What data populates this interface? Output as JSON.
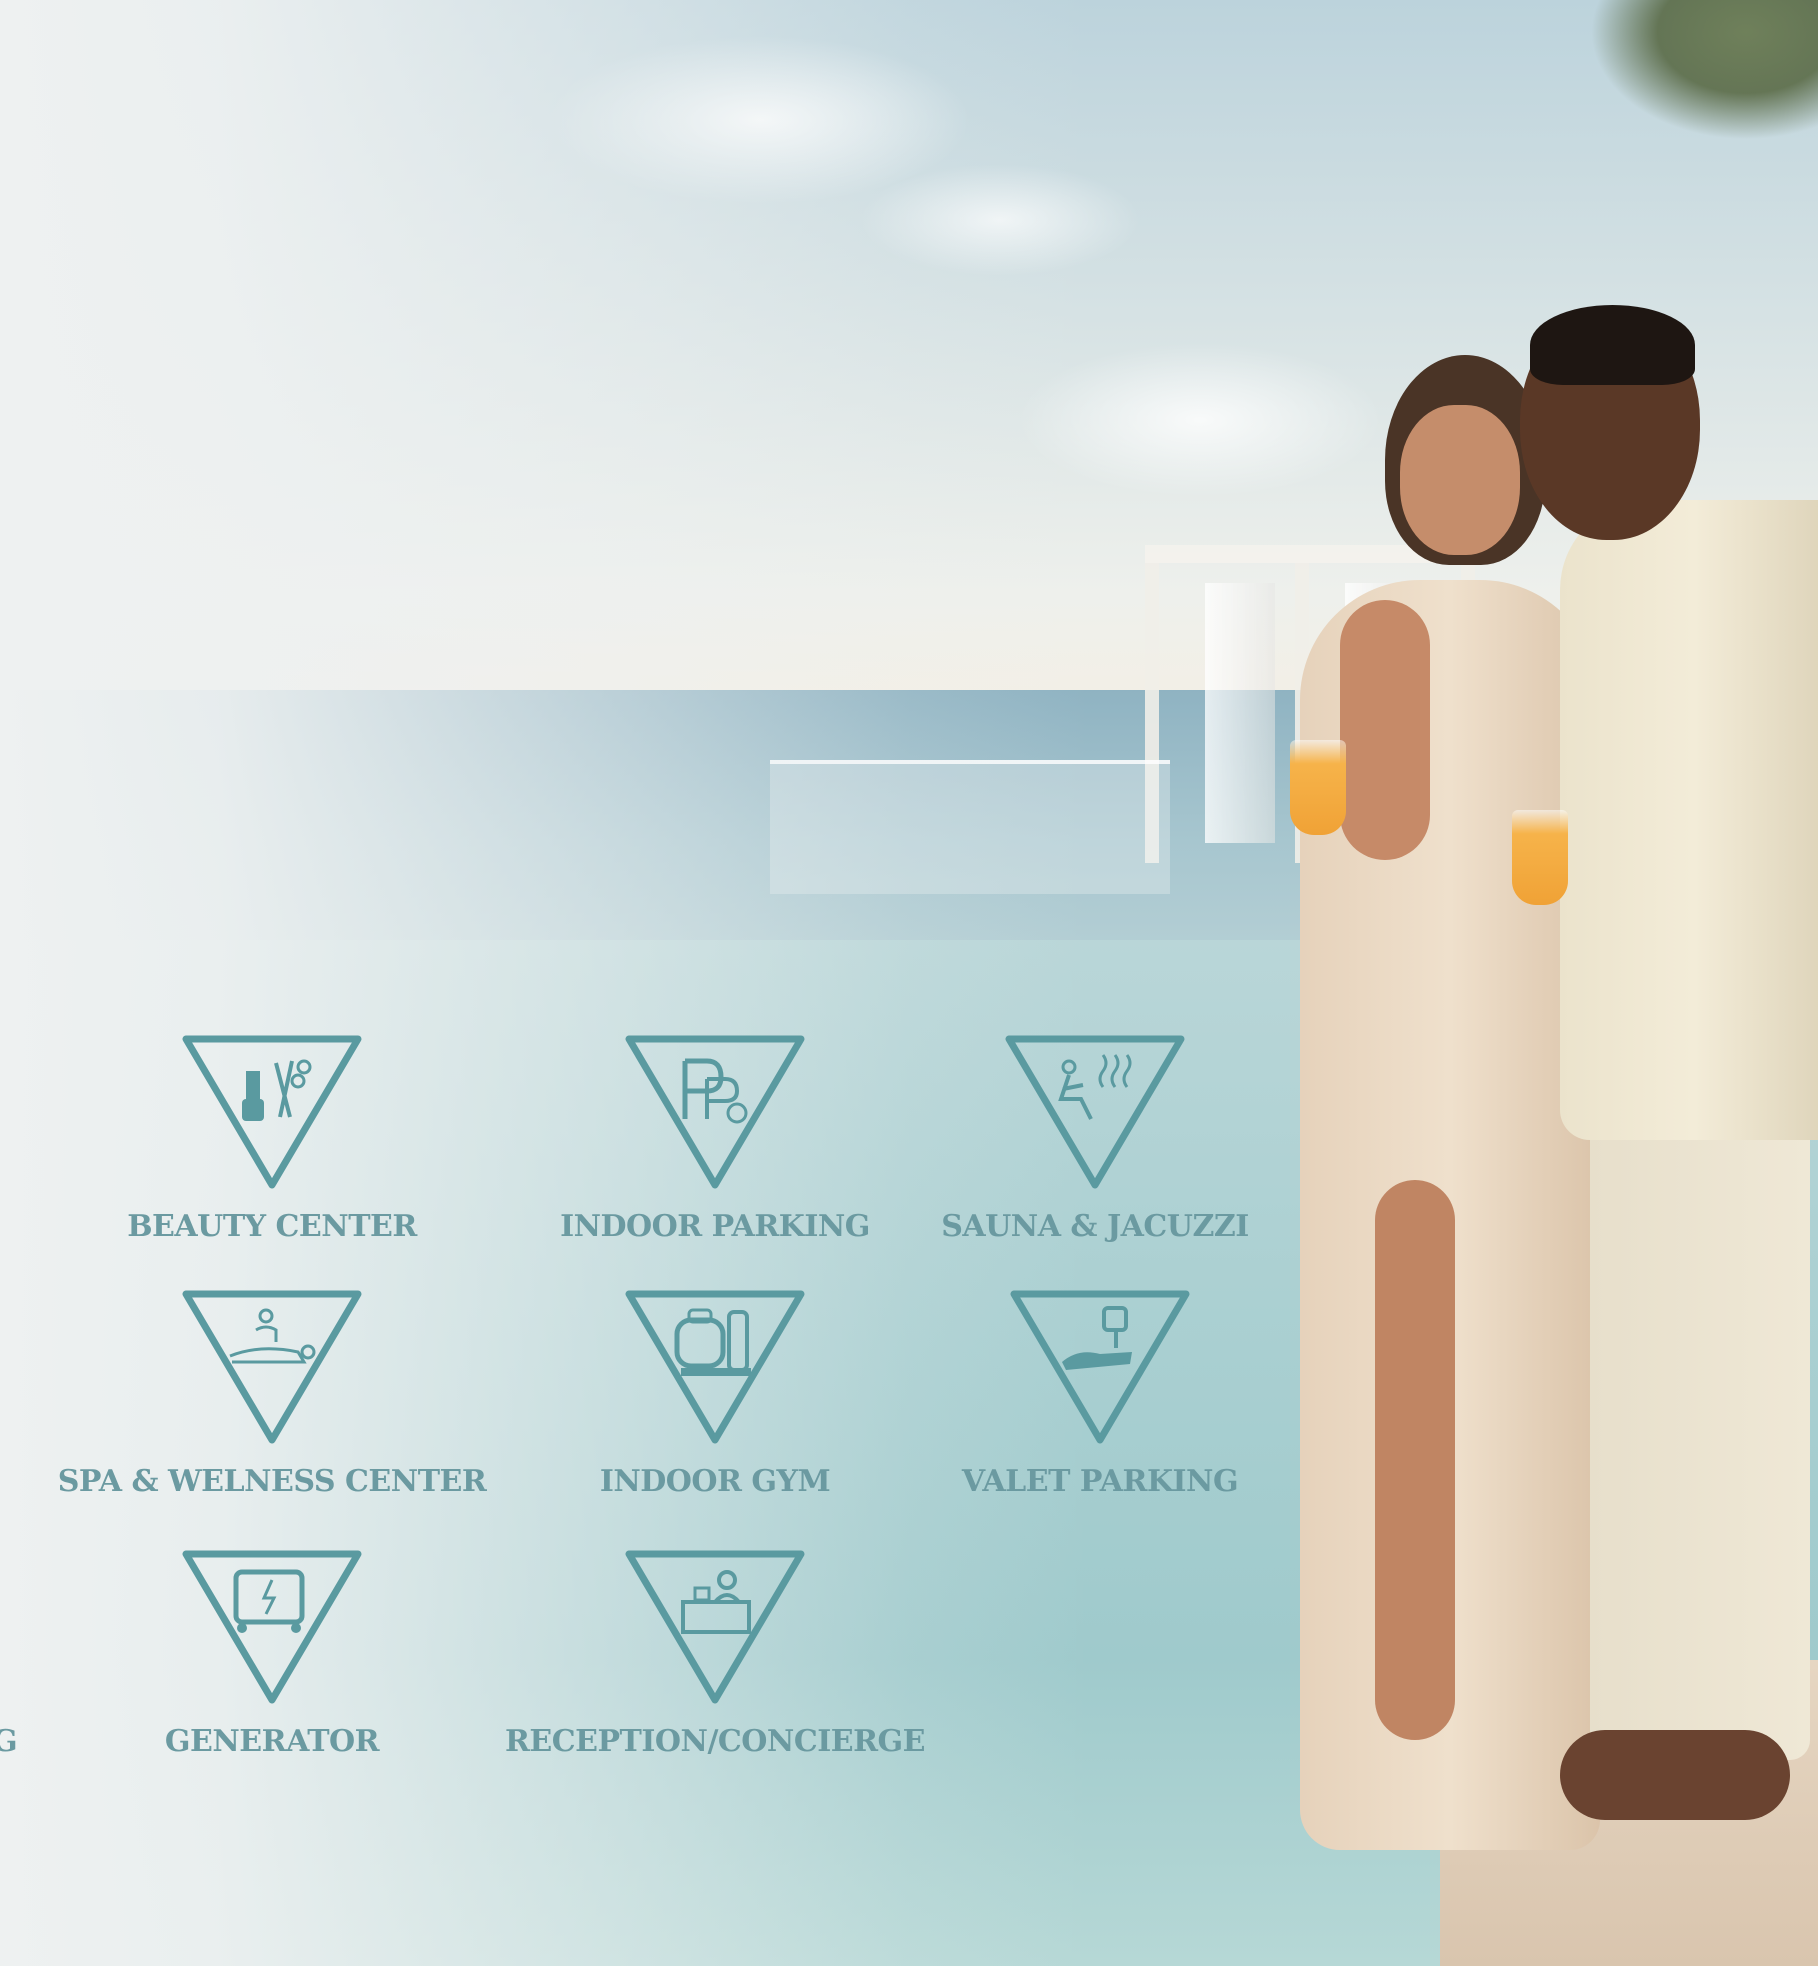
{
  "amenities": [
    {
      "label": "BEAUTY CENTER",
      "icon": "beauty-center-icon"
    },
    {
      "label": "INDOOR PARKING",
      "icon": "parking-icon"
    },
    {
      "label": "SAUNA & JACUZZI",
      "icon": "sauna-icon"
    },
    {
      "label": "SPA & WELNESS CENTER",
      "icon": "spa-massage-icon"
    },
    {
      "label": "INDOOR GYM",
      "icon": "gym-icon"
    },
    {
      "label": "VALET PARKING",
      "icon": "valet-icon"
    },
    {
      "label": "GENERATOR",
      "icon": "generator-icon"
    },
    {
      "label": "RECEPTION/CONCIERGE",
      "icon": "reception-icon"
    }
  ],
  "edge_text": "G",
  "colors": {
    "accent": "#5a9aa0",
    "label": "#6b9aa1"
  }
}
